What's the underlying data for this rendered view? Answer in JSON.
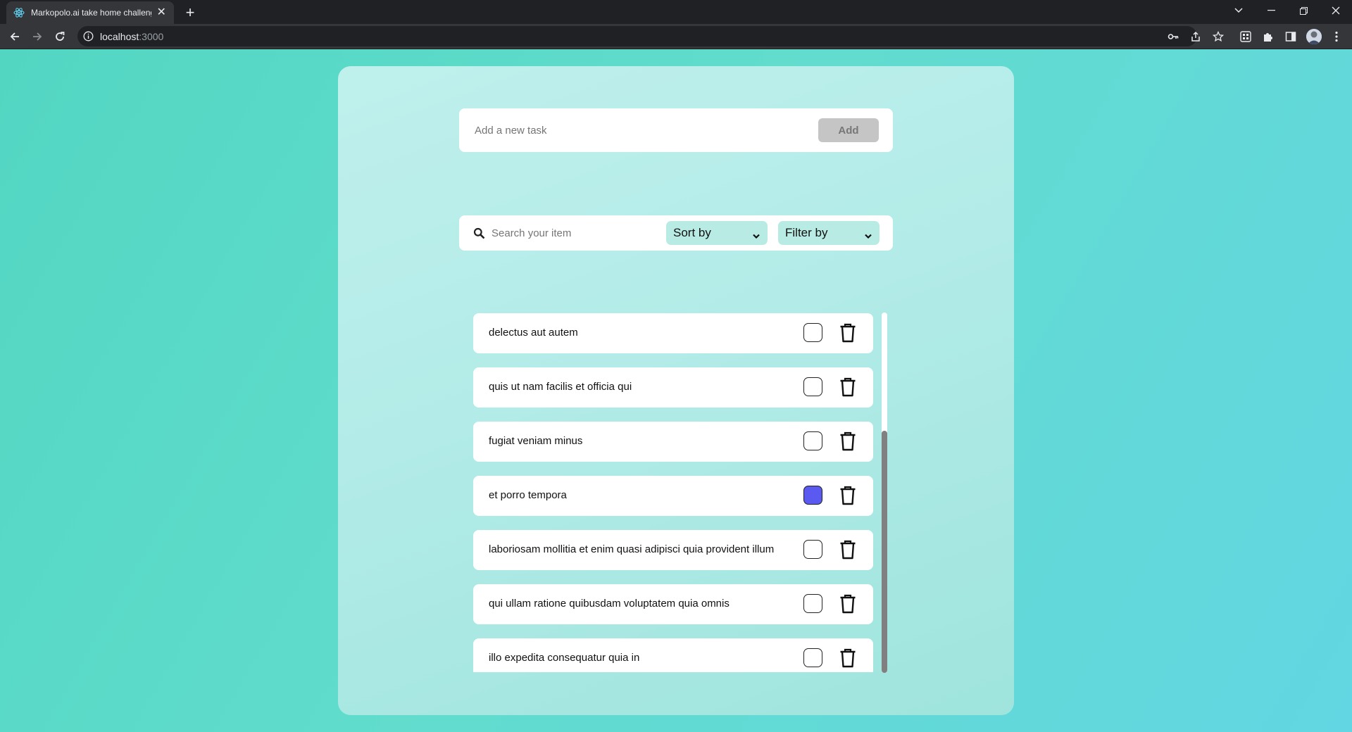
{
  "browser": {
    "tab_title": "Markopolo.ai take home challenge",
    "url_host": "localhost",
    "url_port": ":3000"
  },
  "add_task": {
    "placeholder": "Add a new task",
    "button_label": "Add"
  },
  "controls": {
    "search_placeholder": "Search your item",
    "sort_label": "Sort by",
    "filter_label": "Filter by"
  },
  "tasks": [
    {
      "title": "delectus aut autem",
      "completed": false
    },
    {
      "title": "quis ut nam facilis et officia qui",
      "completed": false
    },
    {
      "title": "fugiat veniam minus",
      "completed": false
    },
    {
      "title": "et porro tempora",
      "completed": true
    },
    {
      "title": "laboriosam mollitia et enim quasi adipisci quia provident illum",
      "completed": false
    },
    {
      "title": "qui ullam ratione quibusdam voluptatem quia omnis",
      "completed": false
    },
    {
      "title": "illo expedita consequatur quia in",
      "completed": false
    }
  ],
  "colors": {
    "checked_accent": "#5a5af0",
    "page_background": "#5fd8cc",
    "card_background": "#b2ebe8"
  }
}
